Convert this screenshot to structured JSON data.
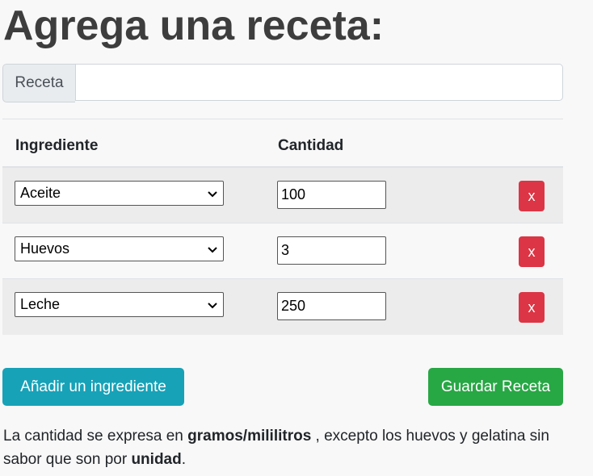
{
  "page": {
    "title": "Agrega una receta:"
  },
  "recipe": {
    "label": "Receta",
    "value": ""
  },
  "table": {
    "headers": {
      "ingredient": "Ingrediente",
      "quantity": "Cantidad"
    },
    "rows": [
      {
        "ingredient": "Aceite",
        "quantity": "100",
        "delete_label": "x"
      },
      {
        "ingredient": "Huevos",
        "quantity": "3",
        "delete_label": "x"
      },
      {
        "ingredient": "Leche",
        "quantity": "250",
        "delete_label": "x"
      }
    ]
  },
  "actions": {
    "add_ingredient": "Añadir un ingrediente",
    "save_recipe": "Guardar Receta"
  },
  "note": {
    "part1": "La cantidad se expresa en ",
    "bold1": "gramos/mililitros",
    "part2": " , excepto los huevos y gelatina sin sabor que son por ",
    "bold2": "unidad",
    "part3": "."
  },
  "colors": {
    "info": "#17a2b8",
    "success": "#28a745",
    "danger": "#dc3545"
  },
  "icons": {
    "select_arrow": "chevron-down-icon"
  }
}
